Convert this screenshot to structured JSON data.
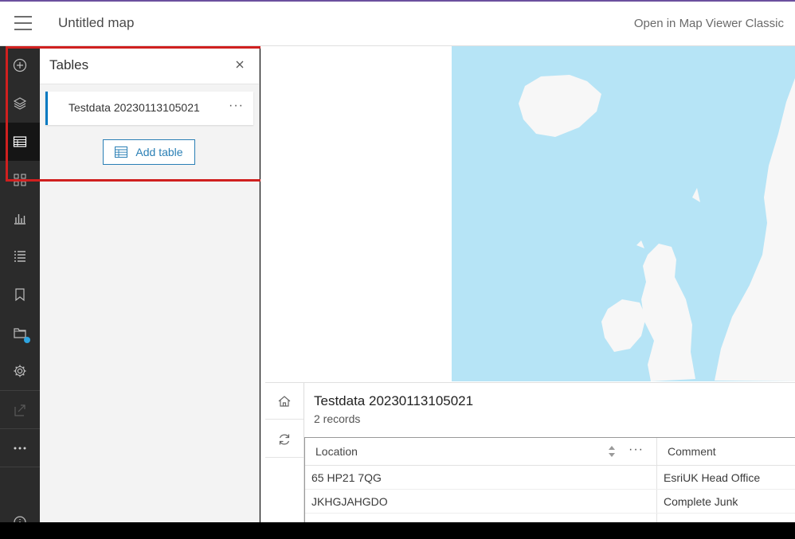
{
  "header": {
    "title": "Untitled map",
    "classic_link": "Open in Map Viewer Classic"
  },
  "action_bar": {
    "items": [
      {
        "icon": "add-icon",
        "active": false
      },
      {
        "icon": "layers-icon",
        "active": false
      },
      {
        "icon": "table-icon",
        "active": true
      },
      {
        "icon": "legend-icon",
        "active": false
      },
      {
        "icon": "charts-icon",
        "active": false
      },
      {
        "icon": "list-icon",
        "active": false
      },
      {
        "icon": "bookmark-icon",
        "active": false
      },
      {
        "icon": "basemap-icon",
        "active": false,
        "badge_color": "#2ea4e0"
      },
      {
        "icon": "gear-icon",
        "active": false
      },
      {
        "icon": "share-icon",
        "active": false
      },
      {
        "icon": "more-icon",
        "active": false
      }
    ]
  },
  "tables_panel": {
    "title": "Tables",
    "close_icon": "close-icon",
    "items": [
      {
        "label": "Testdata 20230113105021",
        "more": "···"
      }
    ],
    "add_button_label": "Add table"
  },
  "table_widget": {
    "title": "Testdata 20230113105021",
    "record_count": "2 records",
    "columns": [
      "Location",
      "Comment"
    ],
    "column_more": "···",
    "rows": [
      [
        "65 HP21 7QG",
        "EsriUK Head Office"
      ],
      [
        "JKHGJAHGDO",
        "Complete Junk"
      ]
    ]
  },
  "colors": {
    "accent": "#0079c1",
    "highlight": "#d0201f",
    "sea": "#b6e4f6",
    "land": "#f7f7f7"
  }
}
